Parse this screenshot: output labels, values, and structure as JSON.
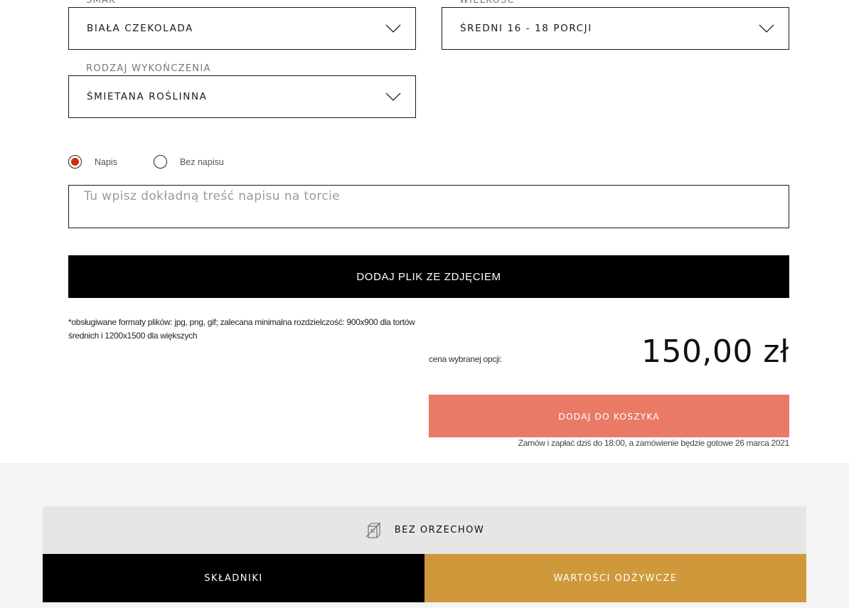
{
  "options": {
    "flavor": {
      "label": "SMAK",
      "value": "BIAŁA CZEKOLADA"
    },
    "size": {
      "label": "WIELKOŚĆ",
      "value": "ŚREDNI 16 - 18 PORCJI"
    },
    "finish": {
      "label": "RODZAJ WYKOŃCZENIA",
      "value": "ŚMIETANA ROŚLINNA"
    }
  },
  "inscription": {
    "options": [
      {
        "label": "Napis",
        "selected": true
      },
      {
        "label": "Bez napisu",
        "selected": false
      }
    ],
    "placeholder": "Tu wpisz dokładną treść napisu na torcie"
  },
  "upload": {
    "button_label": "DODAJ PLIK ZE ZDJĘCIEM",
    "formats_note": "*obsługiwane formaty plików: jpg, png, gif; zalecana minimalna rozdzielczość: 900x900 dla tortów średnich i 1200x1500 dla większych"
  },
  "price": {
    "label": "cena wybranej opcji:",
    "value": "150,00 zł"
  },
  "cart": {
    "button_label": "DODAJ DO KOSZYKA",
    "order_note": "Zamów i zapłać dziś do 18:00, a zamówienie będzie gotowe 26 marca 2021"
  },
  "allergen": {
    "icon": "nut-free-icon",
    "label": "BEZ ORZECHOW"
  },
  "tabs": [
    {
      "label": "SKŁADNIKI"
    },
    {
      "label": "WARTOŚCI ODŻYWCZE"
    }
  ],
  "colors": {
    "accent_salmon": "#e87a66",
    "accent_gold": "#cf983a",
    "radio_selected": "#d62d12"
  }
}
